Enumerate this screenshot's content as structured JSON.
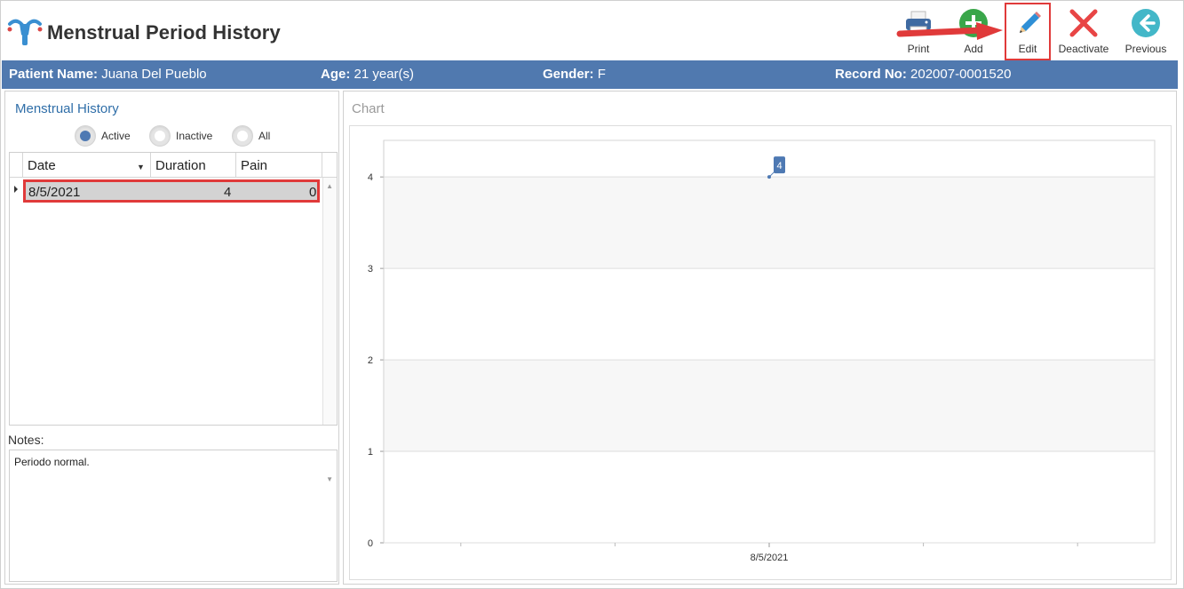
{
  "header": {
    "title": "Menstrual Period History"
  },
  "toolbar": {
    "print_label": "Print",
    "add_label": "Add",
    "edit_label": "Edit",
    "deactivate_label": "Deactivate",
    "previous_label": "Previous"
  },
  "patient": {
    "name_label": "Patient Name:",
    "name_value": "Juana Del Pueblo",
    "age_label": "Age:",
    "age_value": "21 year(s)",
    "gender_label": "Gender:",
    "gender_value": "F",
    "record_label": "Record No:",
    "record_value": "202007-0001520"
  },
  "history": {
    "title": "Menstrual History",
    "filters": [
      {
        "label": "Active",
        "checked": true
      },
      {
        "label": "Inactive",
        "checked": false
      },
      {
        "label": "All",
        "checked": false
      }
    ],
    "columns": [
      "Date",
      "Duration",
      "Pain"
    ],
    "rows": [
      {
        "date": "8/5/2021",
        "duration": "4",
        "pain": "0"
      }
    ]
  },
  "notes": {
    "label": "Notes:",
    "text": "Periodo normal."
  },
  "chart_panel": {
    "title": "Chart"
  },
  "colors": {
    "accent": "#5079af",
    "highlight": "#e03a3a",
    "add_green": "#3aa64a",
    "previous_teal": "#43b7c8"
  },
  "chart_data": {
    "type": "line",
    "categories": [
      "8/5/2021"
    ],
    "series": [
      {
        "values": [
          4
        ]
      }
    ],
    "ylim": [
      0,
      4.4
    ],
    "yticks": [
      0,
      1,
      2,
      3,
      4
    ],
    "data_labels": [
      "4"
    ],
    "grid": true
  }
}
